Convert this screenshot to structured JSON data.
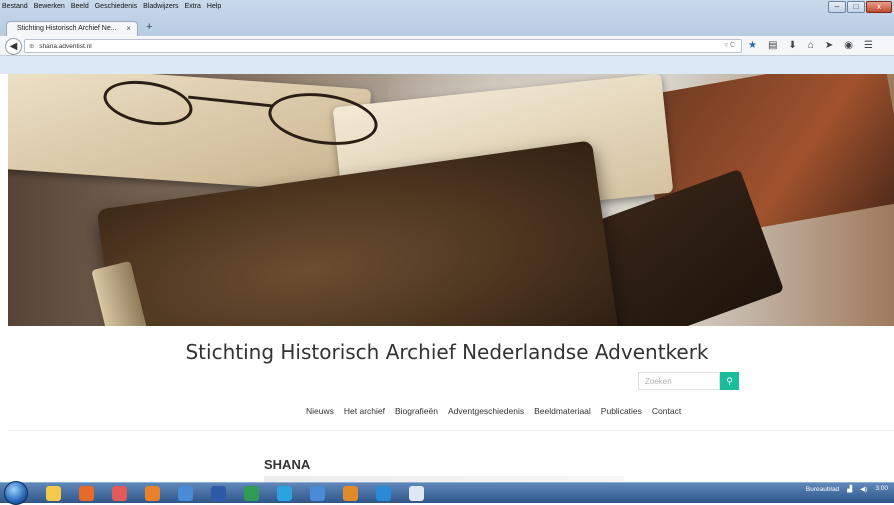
{
  "browser": {
    "menu": [
      "Bestand",
      "Bewerken",
      "Beeld",
      "Geschiedenis",
      "Bladwijzers",
      "Extra",
      "Help"
    ],
    "tab_title": "Stichting Historisch Archief Ne...",
    "tab_close": "×",
    "new_tab": "+",
    "url": "shana.adventist.nl",
    "url_right": "▿ C",
    "window_buttons": {
      "minimize": "–",
      "maximize": "□",
      "close": "x"
    }
  },
  "site": {
    "title": "Stichting Historisch Archief Nederlandse Adventkerk",
    "search_placeholder": "Zoeken",
    "search_icon": "⚲",
    "nav": [
      "Nieuws",
      "Het archief",
      "Biografieën",
      "Adventgeschiedenis",
      "Beeldmateriaal",
      "Publicaties",
      "Contact"
    ],
    "page_heading": "SHANA"
  },
  "taskbar": {
    "icon_colors": [
      "#f2c94c",
      "#e86a2a",
      "#e25a5a",
      "#e7812a",
      "#4a8ad6",
      "#2f5aa8",
      "#2f9b57",
      "#2aa3e0",
      "#4a8ad6",
      "#e08a2a",
      "#2a8ad6",
      "#dfe8f4"
    ],
    "desktop_label": "Bureaublad",
    "clock_time": "3:00"
  }
}
